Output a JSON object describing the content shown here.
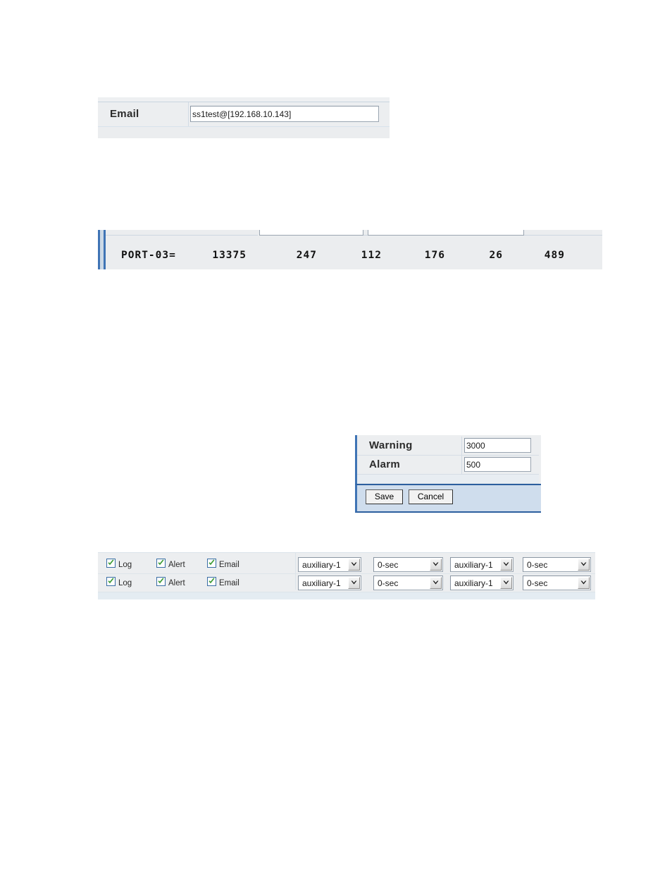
{
  "email_panel": {
    "label": "Email",
    "value": "ss1test@[192.168.10.143]"
  },
  "port_stats": {
    "name": "PORT-03=",
    "values": [
      "13375",
      "247",
      "112",
      "176",
      "26",
      "489"
    ]
  },
  "threshold_panel": {
    "rows": [
      {
        "label": "Warning",
        "value": "3000"
      },
      {
        "label": "Alarm",
        "value": "500"
      }
    ],
    "save_label": "Save",
    "cancel_label": "Cancel"
  },
  "options_panel": {
    "rows": [
      {
        "checkboxes": [
          {
            "label": "Log",
            "checked": true
          },
          {
            "label": "Alert",
            "checked": true
          },
          {
            "label": "Email",
            "checked": true
          }
        ],
        "selects": [
          "auxiliary-1",
          "0-sec",
          "auxiliary-1",
          "0-sec"
        ]
      },
      {
        "checkboxes": [
          {
            "label": "Log",
            "checked": true
          },
          {
            "label": "Alert",
            "checked": true
          },
          {
            "label": "Email",
            "checked": true
          }
        ],
        "selects": [
          "auxiliary-1",
          "0-sec",
          "auxiliary-1",
          "0-sec"
        ]
      }
    ]
  },
  "colors": {
    "accent_blue": "#3f74b5",
    "panel_bg": "#eceef0",
    "checkbox_border": "#3a6ea5",
    "check_green": "#3d9b35",
    "footer_bg": "#cfdded"
  }
}
